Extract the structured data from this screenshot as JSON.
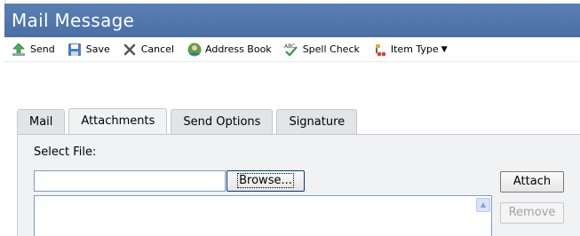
{
  "window": {
    "title": "Mail Message"
  },
  "toolbar": {
    "items": [
      {
        "label": "Send",
        "icon": "send-icon"
      },
      {
        "label": "Save",
        "icon": "save-icon"
      },
      {
        "label": "Cancel",
        "icon": "cancel-icon"
      },
      {
        "label": "Address Book",
        "icon": "address-book-icon"
      },
      {
        "label": "Spell Check",
        "icon": "spell-check-icon"
      },
      {
        "label": "Item Type",
        "icon": "item-type-icon",
        "dropdown": true
      }
    ]
  },
  "tabs": [
    {
      "label": "Mail",
      "active": false
    },
    {
      "label": "Attachments",
      "active": true
    },
    {
      "label": "Send Options",
      "active": false
    },
    {
      "label": "Signature",
      "active": false
    }
  ],
  "attachments": {
    "select_file_label": "Select File:",
    "file_value": "",
    "browse_label": "Browse...",
    "attach_label": "Attach",
    "remove_label": "Remove"
  },
  "colors": {
    "title_bar": "#4a6fa5",
    "panel_bg": "#f1f2f4"
  }
}
